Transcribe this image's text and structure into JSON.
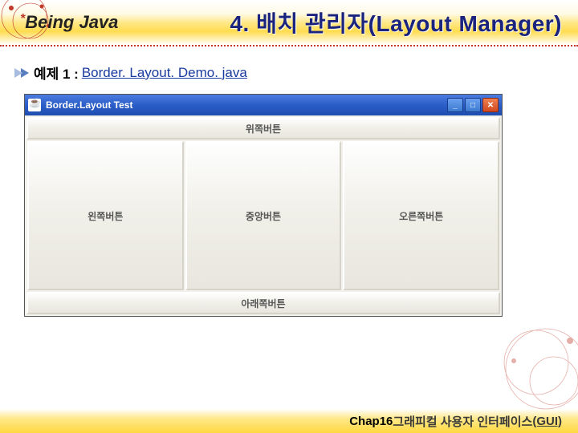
{
  "header": {
    "logo_text": "Being Java",
    "title": "4. 배치 관리자(Layout Manager)"
  },
  "content": {
    "bullet_prefix": "예제 1 : ",
    "link_text": "Border. Layout. Demo. java"
  },
  "window": {
    "title": "Border.Layout Test",
    "buttons": {
      "north": "위쪽버튼",
      "west": "왼쪽버튼",
      "center": "중앙버튼",
      "east": "오른쪽버튼",
      "south": "아래쪽버튼"
    },
    "controls": {
      "minimize": "_",
      "maximize": "□",
      "close": "✕"
    }
  },
  "footer": {
    "chapter": "Chap16",
    "text": " 그래피컬 사용자 인터페이스",
    "tag": "(GUI)"
  }
}
